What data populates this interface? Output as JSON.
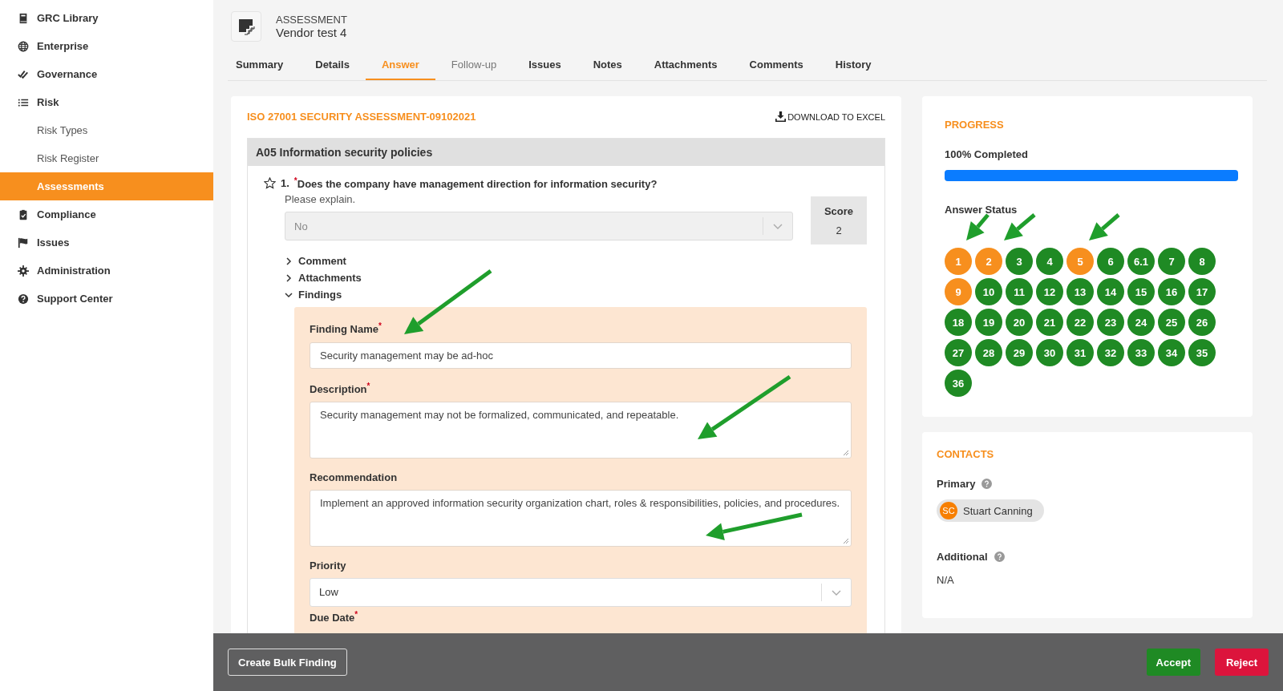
{
  "sidebar": {
    "items": [
      {
        "label": "GRC Library",
        "selected": false
      },
      {
        "label": "Enterprise",
        "selected": false
      },
      {
        "label": "Governance",
        "selected": false
      },
      {
        "label": "Risk",
        "selected": false,
        "children": [
          {
            "label": "Risk Types",
            "selected": false
          },
          {
            "label": "Risk Register",
            "selected": false
          },
          {
            "label": "Assessments",
            "selected": true
          }
        ]
      },
      {
        "label": "Compliance",
        "selected": false
      },
      {
        "label": "Issues",
        "selected": false
      },
      {
        "label": "Administration",
        "selected": false
      },
      {
        "label": "Support Center",
        "selected": false
      }
    ]
  },
  "header": {
    "kind_label": "ASSESSMENT",
    "title": "Vendor test 4"
  },
  "tabs": [
    {
      "label": "Summary",
      "selected": false,
      "disabled": false
    },
    {
      "label": "Details",
      "selected": false,
      "disabled": false
    },
    {
      "label": "Answer",
      "selected": true,
      "disabled": false
    },
    {
      "label": "Follow-up",
      "selected": false,
      "disabled": true
    },
    {
      "label": "Issues",
      "selected": false,
      "disabled": false
    },
    {
      "label": "Notes",
      "selected": false,
      "disabled": false
    },
    {
      "label": "Attachments",
      "selected": false,
      "disabled": false
    },
    {
      "label": "Comments",
      "selected": false,
      "disabled": false
    },
    {
      "label": "History",
      "selected": false,
      "disabled": false
    }
  ],
  "assessment": {
    "title": "ISO 27001 SECURITY ASSESSMENT-09102021",
    "download": "DOWNLOAD TO EXCEL",
    "section": "A05 Information security policies",
    "question": {
      "number": "1.",
      "text": "$^{*}$Does the company have management direction for information security?",
      "hint": "Please explain.",
      "answer": {
        "value": "No",
        "disabled": true
      },
      "score_label": "Score",
      "score": "2",
      "panels": [
        {
          "label": "Comment",
          "expanded": false
        },
        {
          "label": "Attachments",
          "expanded": false
        },
        {
          "label": "Findings",
          "expanded": true
        }
      ],
      "findings": {
        "fields": [
          {
            "kind": "input",
            "label": "Finding Name$^{*}$",
            "value": "Security management may be ad-hoc"
          },
          {
            "kind": "textarea",
            "label": "Description$^{*}$",
            "value": "Security management may not be formalized, communicated, and repeatable."
          },
          {
            "kind": "textarea",
            "label": "Recommendation",
            "value": "Implement an approved information security organization chart, roles & responsibilities, policies, and procedures."
          },
          {
            "kind": "select",
            "label": "Priority",
            "value": "Low"
          },
          {
            "kind": "label",
            "label": "Due Date$^{*}$"
          }
        ]
      }
    }
  },
  "progress": {
    "title": "PROGRESS",
    "completion": "100% Completed",
    "level": 1,
    "status_label": "Answer Status",
    "answers": [
      {
        "label": "1",
        "color": "#f78f1e"
      },
      {
        "label": "2",
        "color": "#f78f1e"
      },
      {
        "label": "3",
        "color": "#1f8a24"
      },
      {
        "label": "4",
        "color": "#1f8a24"
      },
      {
        "label": "5",
        "color": "#f78f1e"
      },
      {
        "label": "6",
        "color": "#1f8a24"
      },
      {
        "label": "6.1",
        "color": "#1f8a24"
      },
      {
        "label": "7",
        "color": "#1f8a24"
      },
      {
        "label": "8",
        "color": "#1f8a24"
      },
      {
        "label": "9",
        "color": "#f78f1e"
      },
      {
        "label": "10",
        "color": "#1f8a24"
      },
      {
        "label": "11",
        "color": "#1f8a24"
      },
      {
        "label": "12",
        "color": "#1f8a24"
      },
      {
        "label": "13",
        "color": "#1f8a24"
      },
      {
        "label": "14",
        "color": "#1f8a24"
      },
      {
        "label": "15",
        "color": "#1f8a24"
      },
      {
        "label": "16",
        "color": "#1f8a24"
      },
      {
        "label": "17",
        "color": "#1f8a24"
      },
      {
        "label": "18",
        "color": "#1f8a24"
      },
      {
        "label": "19",
        "color": "#1f8a24"
      },
      {
        "label": "20",
        "color": "#1f8a24"
      },
      {
        "label": "21",
        "color": "#1f8a24"
      },
      {
        "label": "22",
        "color": "#1f8a24"
      },
      {
        "label": "23",
        "color": "#1f8a24"
      },
      {
        "label": "24",
        "color": "#1f8a24"
      },
      {
        "label": "25",
        "color": "#1f8a24"
      },
      {
        "label": "26",
        "color": "#1f8a24"
      },
      {
        "label": "27",
        "color": "#1f8a24"
      },
      {
        "label": "28",
        "color": "#1f8a24"
      },
      {
        "label": "29",
        "color": "#1f8a24"
      },
      {
        "label": "30",
        "color": "#1f8a24"
      },
      {
        "label": "31",
        "color": "#1f8a24"
      },
      {
        "label": "32",
        "color": "#1f8a24"
      },
      {
        "label": "33",
        "color": "#1f8a24"
      },
      {
        "label": "34",
        "color": "#1f8a24"
      },
      {
        "label": "35",
        "color": "#1f8a24"
      },
      {
        "label": "36",
        "color": "#1f8a24"
      }
    ]
  },
  "contacts": {
    "title": "CONTACTS",
    "primary_label": "Primary",
    "primary": {
      "initials": "SC",
      "name": "Stuart Canning"
    },
    "additional_label": "Additional",
    "additional": "N/A"
  },
  "bottom_bar": {
    "buttons": [
      {
        "label": "Create Bulk Finding",
        "kind": "outline"
      },
      {
        "label": "Accept",
        "kind": "accept"
      },
      {
        "label": "Reject",
        "kind": "reject"
      }
    ]
  }
}
